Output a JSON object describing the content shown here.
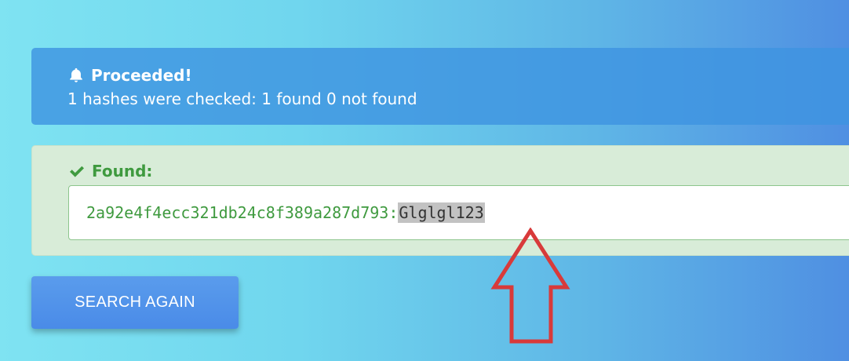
{
  "alert": {
    "icon": "bell-icon",
    "title": "Proceeded!",
    "message": "1 hashes were checked: 1 found 0 not found"
  },
  "result": {
    "icon": "check-icon",
    "title": "Found:",
    "hash": "2a92e4f4ecc321db24c8f389a287d793",
    "separator": ":",
    "plaintext": "Glglgl123"
  },
  "actions": {
    "search_again_label": "SEARCH AGAIN"
  },
  "annotation": {
    "icon": "up-arrow-icon",
    "color": "#d83a3a"
  },
  "colors": {
    "info_alert": "#3e94e0",
    "success_text": "#3f9a3f",
    "success_bg": "#d8ecd8",
    "button": "#4a8be8"
  }
}
